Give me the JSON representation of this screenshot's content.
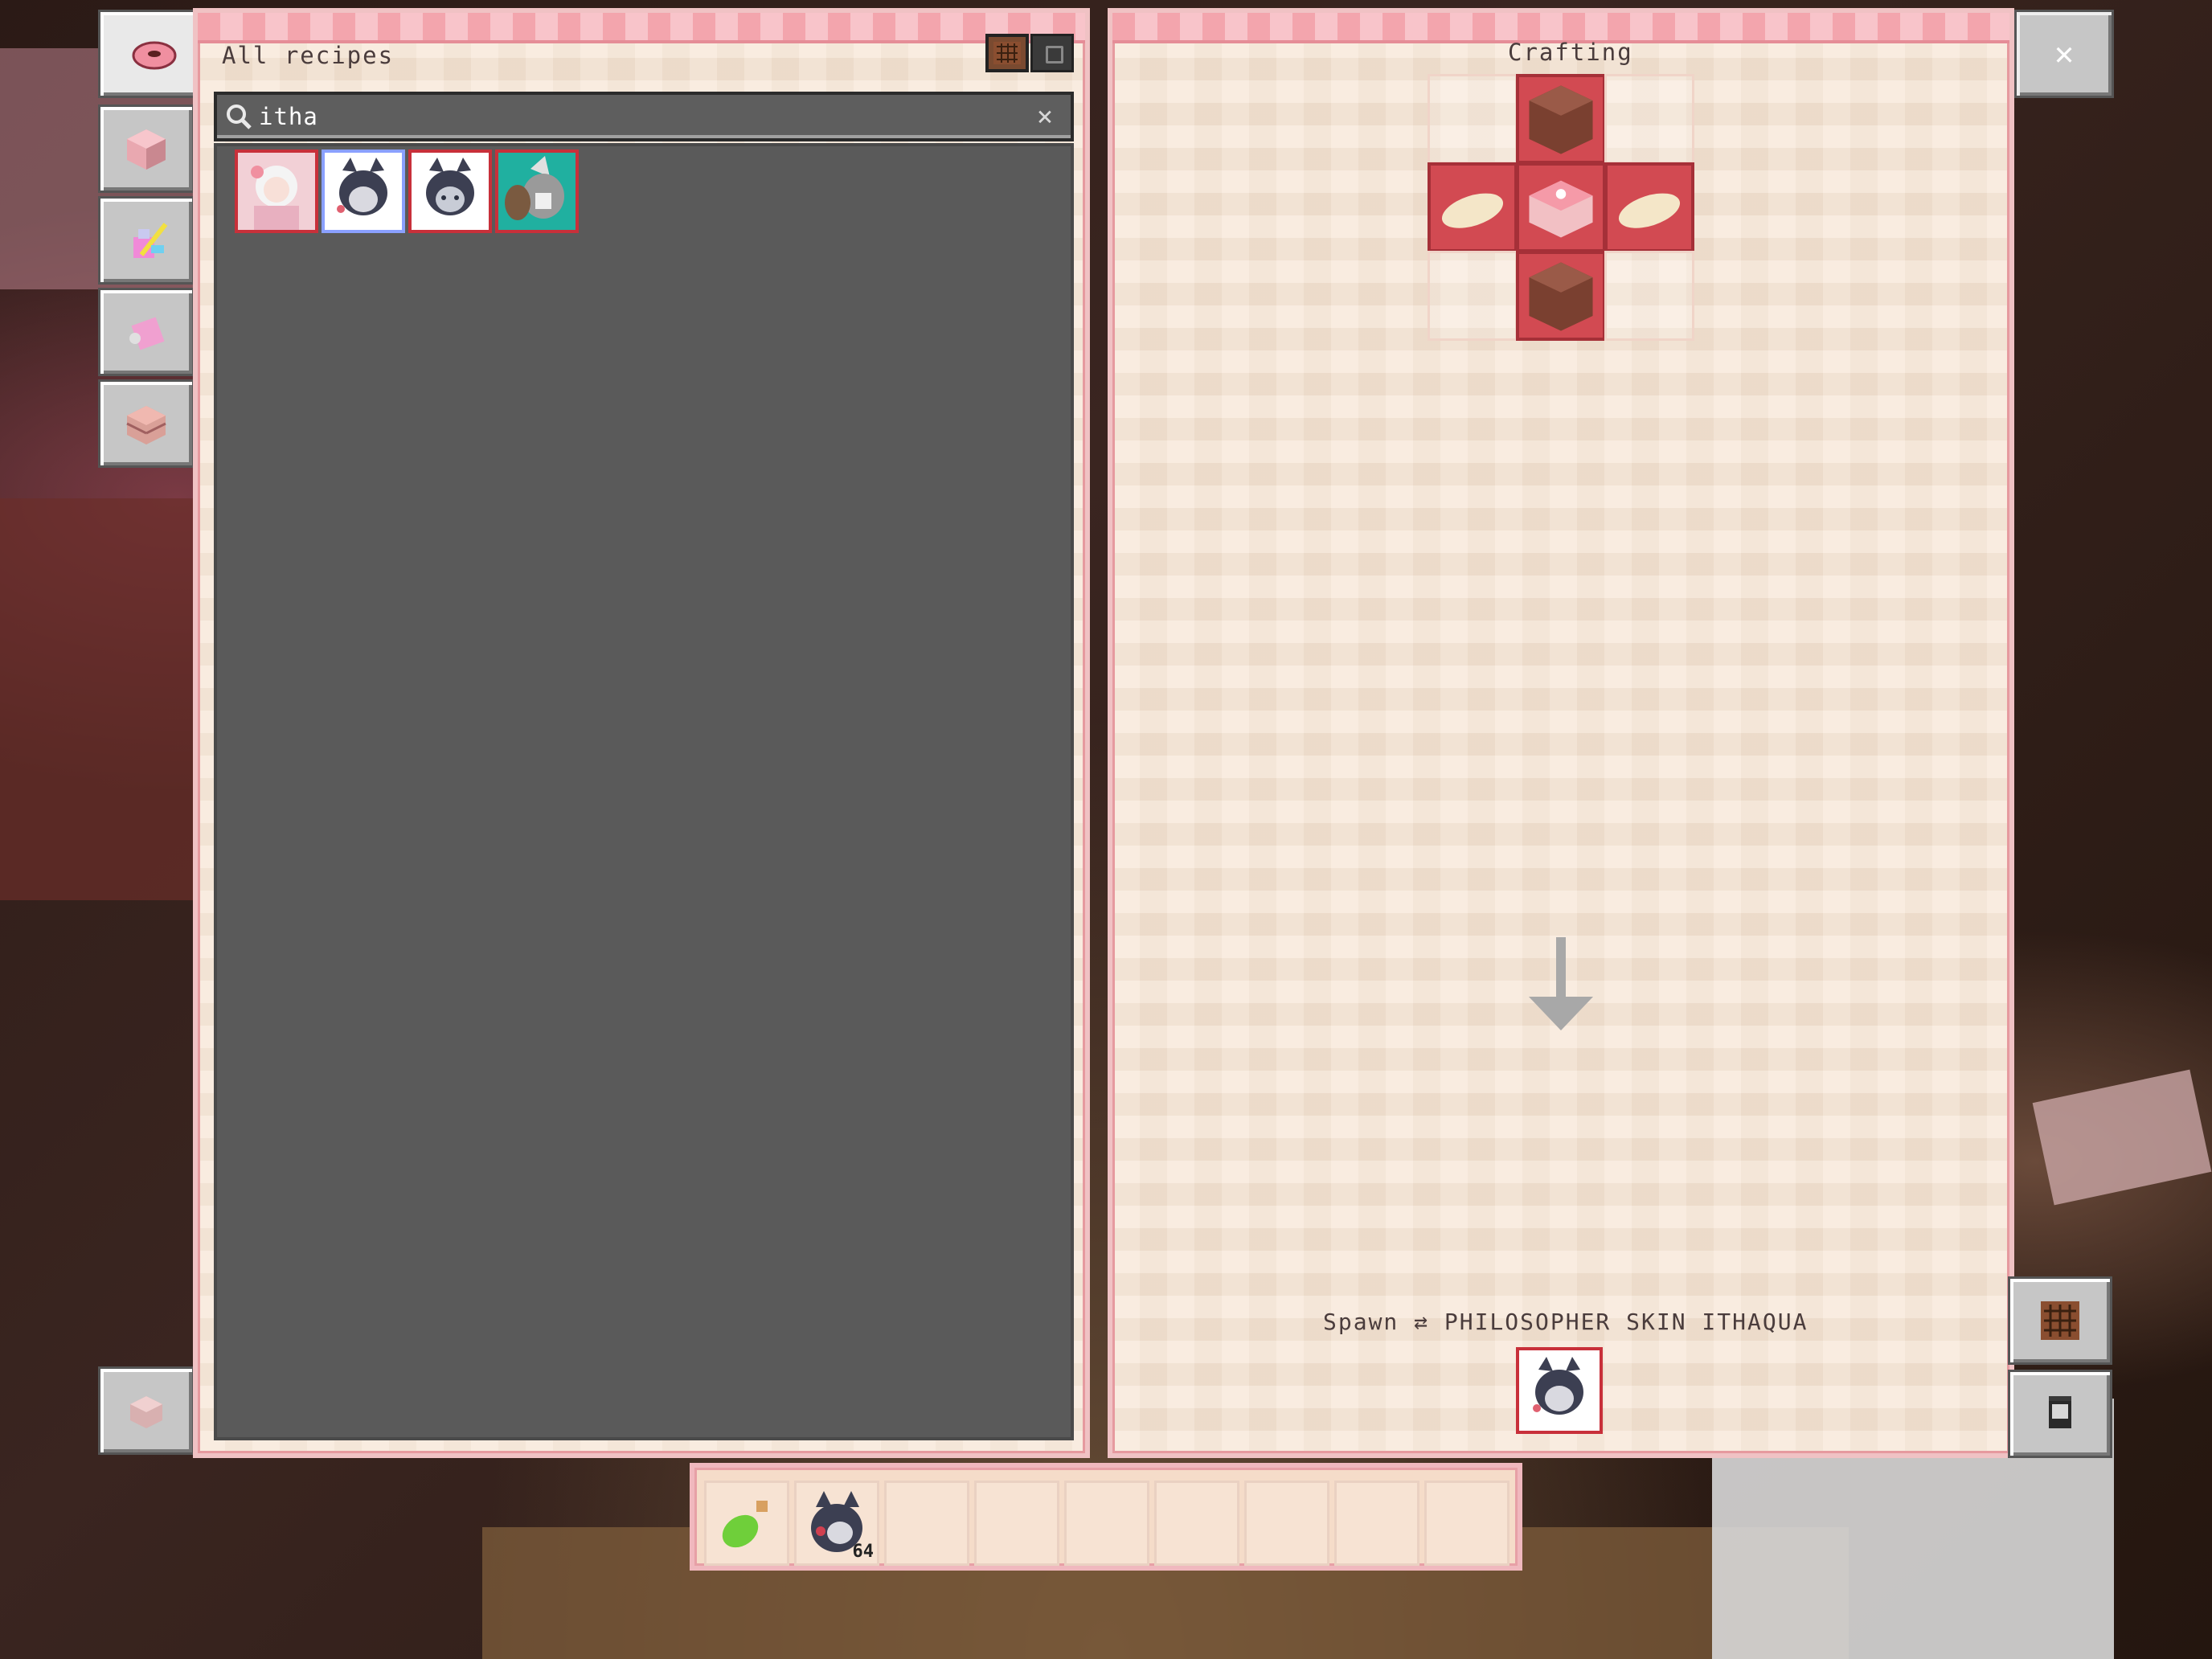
{
  "left_panel": {
    "title": "All recipes",
    "search": {
      "value": "itha",
      "placeholder": ""
    },
    "results": [
      {
        "name": "skin-card-white-hair"
      },
      {
        "name": "skin-card-ithaqua-selected"
      },
      {
        "name": "skin-card-ithaqua"
      },
      {
        "name": "skin-card-gray-wolf"
      }
    ]
  },
  "right_panel": {
    "title": "Crafting",
    "recipe_label": "Spawn ⇄ PHILOSOPHER SKIN ITHAQUA"
  },
  "hotbar": {
    "slot1_item": "lime-dye",
    "slot2_item": "ithaqua-skin",
    "slot2_count": "64"
  },
  "colors": {
    "panel_bg": "#f7e4d3",
    "trim_pink": "#f3a5ad",
    "slot_red": "#d24a52",
    "results_bg": "#5a5a5a"
  }
}
